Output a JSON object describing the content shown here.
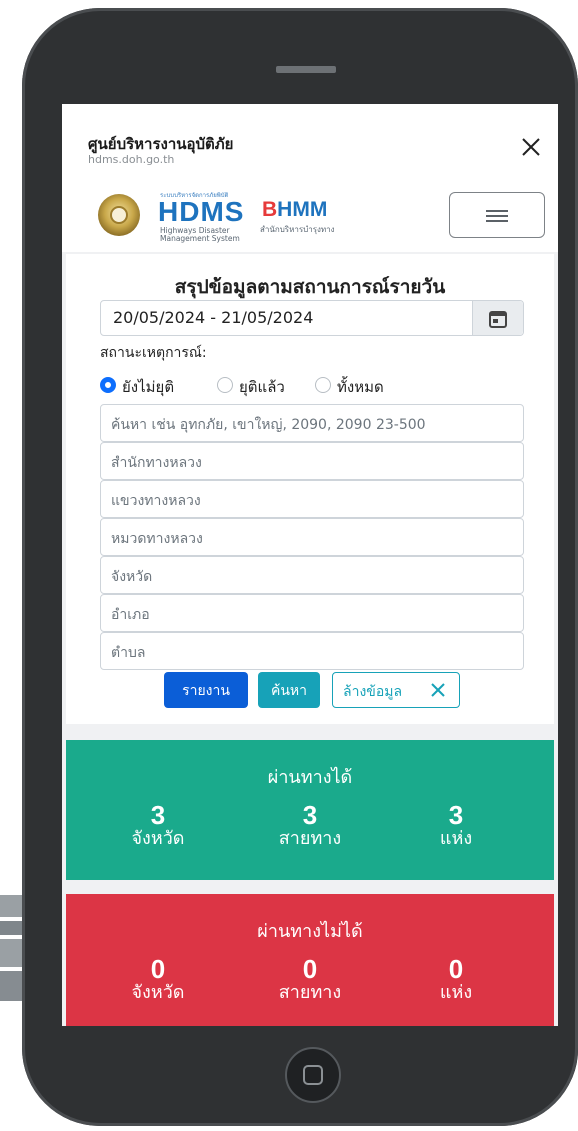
{
  "app": {
    "title": "ศูนย์บริหารงานอุบัติภัย",
    "url": "hdms.doh.go.th"
  },
  "logos": {
    "hdms_small": "ระบบบริหารจัดการภัยพิบัติ",
    "hdms": "HDMS",
    "hdms_sub1": "Highways Disaster",
    "hdms_sub2": "Management System",
    "bhmm_b": "B",
    "bhmm_h": "H",
    "bhmm_mm": "MM",
    "bhmm_sub": "สำนักบริหารบำรุงทาง"
  },
  "icons": {
    "close": "close-icon",
    "menu": "hamburger-icon",
    "calendar": "calendar-icon",
    "clear": "x-icon"
  },
  "form": {
    "title": "สรุปข้อมูลตามสถานการณ์รายวัน",
    "date_range": "20/05/2024 - 21/05/2024",
    "status_label": "สถานะเหตุการณ์:",
    "radios": [
      {
        "label": "ยังไม่ยุติ",
        "checked": true
      },
      {
        "label": "ยุติแล้ว",
        "checked": false
      },
      {
        "label": "ทั้งหมด",
        "checked": false
      }
    ],
    "search_placeholder": "ค้นหา เช่น อุทกภัย, เขาใหญ่, 2090, 2090 23-500",
    "fields": [
      "สำนักทางหลวง",
      "แขวงทางหลวง",
      "หมวดทางหลวง",
      "จังหวัด",
      "อำเภอ",
      "ตำบล"
    ],
    "buttons": {
      "report": "รายงาน",
      "search": "ค้นหา",
      "clear": "ล้างข้อมูล"
    }
  },
  "passable": {
    "title": "ผ่านทางได้",
    "stats": [
      {
        "value": "3",
        "unit": "จังหวัด"
      },
      {
        "value": "3",
        "unit": "สายทาง"
      },
      {
        "value": "3",
        "unit": "แห่ง"
      }
    ]
  },
  "impassable": {
    "title": "ผ่านทางไม่ได้",
    "stats": [
      {
        "value": "0",
        "unit": "จังหวัด"
      },
      {
        "value": "0",
        "unit": "สายทาง"
      },
      {
        "value": "0",
        "unit": "แห่ง"
      }
    ]
  },
  "colors": {
    "primary": "#0b5ed7",
    "info": "#17a2b8",
    "success_panel": "#1aaa8c",
    "danger_panel": "#dc3545"
  }
}
